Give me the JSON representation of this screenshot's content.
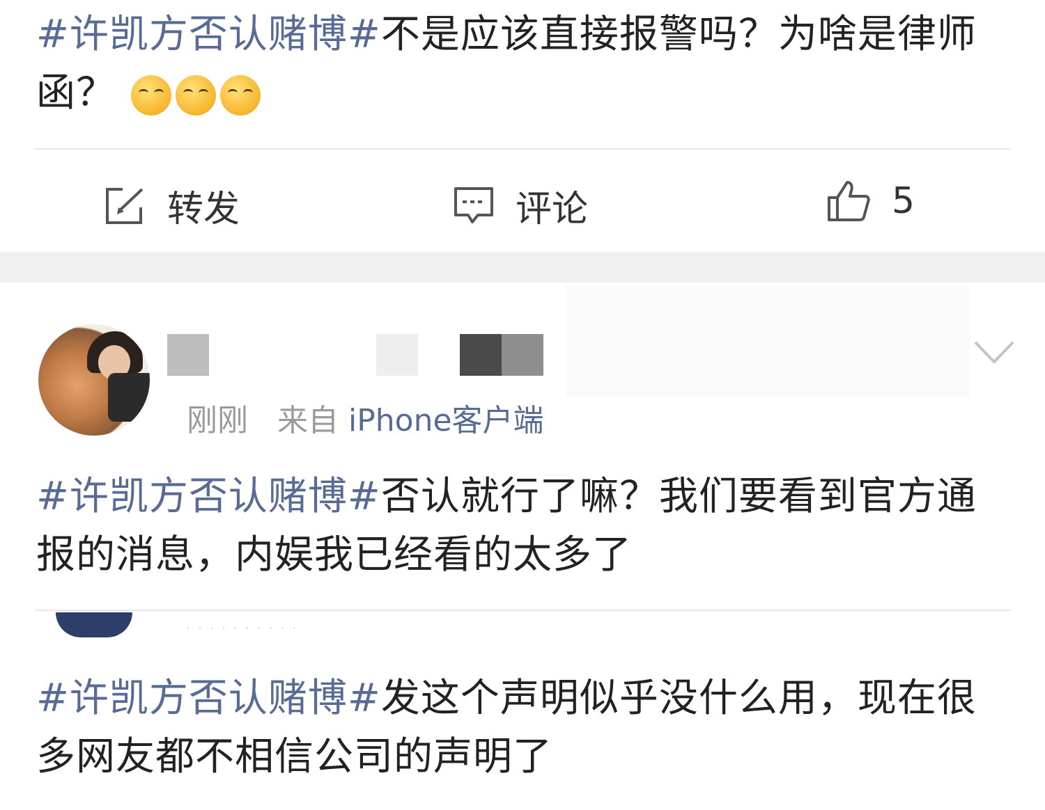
{
  "post1": {
    "topic": "#许凯方否认赌博#",
    "text": "不是应该直接报警吗？为啥是律师函？",
    "emoji": [
      "smirk-emoji",
      "smirk-emoji",
      "smirk-emoji"
    ]
  },
  "actions": {
    "repost_label": "转发",
    "comment_label": "评论",
    "like_count": "5"
  },
  "post2": {
    "time": "刚刚",
    "source_prefix": "来自",
    "source_client": "iPhone客户端",
    "topic": "#许凯方否认赌博#",
    "text": "否认就行了嘛？我们要看到官方通报的消息，内娱我已经看的太多了"
  },
  "post3": {
    "topic": "#许凯方否认赌博#",
    "text": "发这个声明似乎没什么用，现在很多网友都不相信公司的声明了"
  },
  "colors": {
    "topic": "#576b95",
    "text": "#222222",
    "meta": "#9a9a9a",
    "divider": "#e8e8e8",
    "band": "#f0f0f0"
  }
}
